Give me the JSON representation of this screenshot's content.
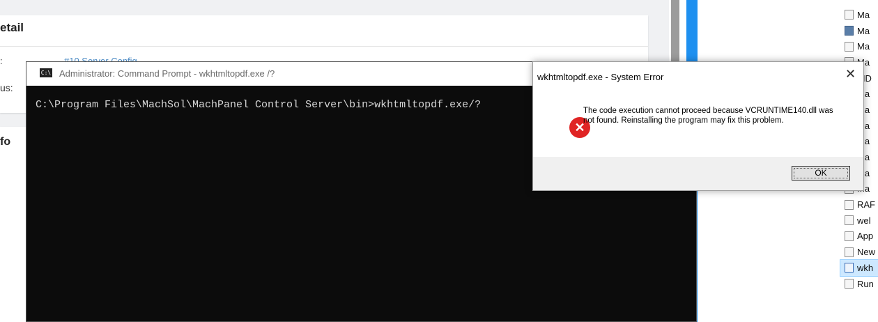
{
  "background_page": {
    "card_title": "etail",
    "label_1": ":",
    "label_2": "us:",
    "link_text": "#10 Server Config...",
    "card2_title": "fo"
  },
  "file_list": {
    "items": [
      {
        "label": "Ma",
        "icon": "file-icon"
      },
      {
        "label": "Ma",
        "icon": "app-icon"
      },
      {
        "label": "Ma",
        "icon": "file-icon"
      },
      {
        "label": "Ma",
        "icon": "file-icon"
      },
      {
        "label": "FID",
        "icon": "file-icon"
      },
      {
        "label": "Ma",
        "icon": "file-icon"
      },
      {
        "label": "Ma",
        "icon": "file-icon"
      },
      {
        "label": "Ma",
        "icon": "file-icon"
      },
      {
        "label": "Ma",
        "icon": "file-icon"
      },
      {
        "label": "Ma",
        "icon": "file-icon"
      },
      {
        "label": "Ma",
        "icon": "file-icon"
      },
      {
        "label": "Ma",
        "icon": "file-icon"
      },
      {
        "label": "RAF",
        "icon": "file-icon"
      },
      {
        "label": "wel",
        "icon": "file-icon"
      },
      {
        "label": "App",
        "icon": "file-icon"
      },
      {
        "label": "New",
        "icon": "file-icon"
      },
      {
        "label": "wkh",
        "icon": "exe-icon",
        "selected": true
      },
      {
        "label": "Run",
        "icon": "file-icon"
      }
    ]
  },
  "cmd_window": {
    "title": "Administrator: Command Prompt - wkhtmltopdf.exe /?",
    "icon_text": "C:\\",
    "command_line": "C:\\Program Files\\MachSol\\MachPanel Control Server\\bin>wkhtmltopdf.exe/?"
  },
  "error_dialog": {
    "title": "wkhtmltopdf.exe - System Error",
    "close_glyph": "✕",
    "icon_glyph": "✕",
    "message": "The code execution cannot proceed because VCRUNTIME140.dll was not found. Reinstalling the program may fix this problem.",
    "ok_label": "OK"
  },
  "colors": {
    "error_red": "#e02424",
    "accent_blue": "#1e90f0",
    "console_bg": "#0c0c0c"
  }
}
